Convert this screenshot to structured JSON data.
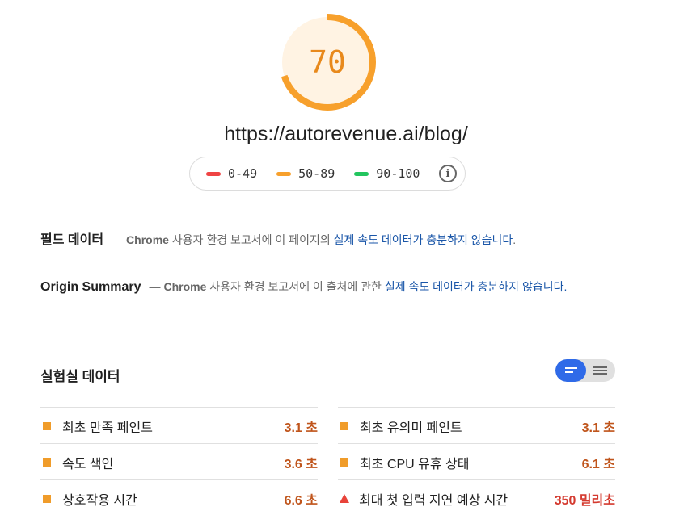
{
  "score": {
    "value": "70",
    "fraction": 0.7,
    "color": "#f7a02c",
    "bg_color": "#fff3e3"
  },
  "url": "https://autorevenue.ai/blog/",
  "legend": {
    "items": [
      {
        "label": "0-49",
        "color": "#ef4444"
      },
      {
        "label": "50-89",
        "color": "#f7a02c"
      },
      {
        "label": "90-100",
        "color": "#22c55e"
      }
    ],
    "info_icon": "info-icon"
  },
  "field_data": {
    "title": "필드 데이터",
    "dash": "—",
    "chrome": "Chrome",
    "text": " 사용자 환경 보고서에 이 페이지의 ",
    "link": "실제 속도 데이터가 충분하지 않습니다",
    "end": "."
  },
  "origin_summary": {
    "title": "Origin Summary",
    "dash": "—",
    "chrome": "Chrome",
    "text": " 사용자 환경 보고서에 이 출처에 관한 ",
    "link": "실제 속도 데이터가 충분하지 않습니다",
    "end": "."
  },
  "lab_data": {
    "title": "실험실 데이터",
    "metrics": [
      {
        "label": "최초 만족 페인트",
        "value": "3.1 초",
        "status": "average"
      },
      {
        "label": "최초 유의미 페인트",
        "value": "3.1 초",
        "status": "average"
      },
      {
        "label": "속도 색인",
        "value": "3.6 초",
        "status": "average"
      },
      {
        "label": "최초 CPU 유휴 상태",
        "value": "6.1 초",
        "status": "average"
      },
      {
        "label": "상호작용 시간",
        "value": "6.6 초",
        "status": "average"
      },
      {
        "label": "최대 첫 입력 지연 예상 시간",
        "value": "350 밀리초",
        "status": "fail"
      }
    ]
  }
}
